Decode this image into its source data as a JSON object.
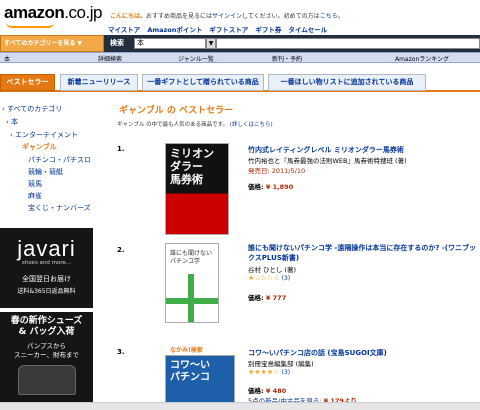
{
  "header": {
    "logo_text": "amazon",
    "logo_suffix": ".co.jp",
    "greeting_hi": "こんにちは。",
    "greeting_rest": "おすすめ商品を見るには",
    "signin_link": "サインイン",
    "greeting_tail": "してください。初めての方は",
    "here_link": "こちら",
    "greeting_end": "。",
    "top_links": [
      "マイストア",
      "Amazonポイント",
      "ギフトストア",
      "ギフト券",
      "タイムセール"
    ]
  },
  "search": {
    "category_button": "すべてのカテゴリーを見る",
    "label": "検索",
    "scope_value": "本"
  },
  "nav": {
    "items": [
      "本",
      "詳細検索",
      "ジャンル一覧",
      "新刊・予約",
      "Amazonランキング"
    ]
  },
  "tabs": [
    {
      "label": "ベストセラー",
      "active": true
    },
    {
      "label": "新着ニューリリース",
      "active": false
    },
    {
      "label": "一番ギフトとして贈られている商品",
      "active": false
    },
    {
      "label": "一番ほしい物リストに追加されている商品",
      "active": false
    }
  ],
  "sidebar": {
    "items": [
      "‹ すべてのカテゴリ",
      "‹ 本",
      "‹ エンターテイメント",
      "ギャンブル",
      "パチンコ・パチスロ",
      "競輪・競艇",
      "競馬",
      "麻雀",
      "宝くじ・ナンバーズ"
    ],
    "current_index": 3
  },
  "ads": {
    "javari_brand": "javari",
    "javari_sub": "shoes and more...",
    "javari_line1": "全国翌日お届け",
    "javari_line2": "送料&365日返品無料",
    "spring_heading1": "春の新作シューズ",
    "spring_heading2": "& バッグ入荷",
    "spring_body1": "パンプスから",
    "spring_body2": "スニーカー、財布まで"
  },
  "main": {
    "title": "ギャンブル の ベストセラー",
    "subtitle": "ギャンブル の中で最も人気のある商品です。",
    "subtitle_link": "詳しくはこちら",
    "items": [
      {
        "rank": "1.",
        "title": "竹内式レイティングレベル ミリオンダラー馬券術",
        "author": "竹内裕也と『馬券最強の法則WEB』馬券術特捜班 (著)",
        "date": "発売日: 2011/5/10",
        "price_label": "価格:",
        "price": "¥ 1,890",
        "cover_text": "ミリオン\nダラー\n馬券術"
      },
      {
        "rank": "2.",
        "title": "誰にも聞けないパチンコ学 -遠隔操作は本当に存在するのか? -(ワニブックスPLUS新書)",
        "author": "谷村 ひとし (著)",
        "rating": "★☆☆☆☆",
        "rating_count": "(3)",
        "price_label": "価格:",
        "price": "¥ 777",
        "cover_text": "誰にも聞けない\nパチンコ学"
      },
      {
        "rank": "3.",
        "title": "コワ〜いパチンコ店の話 (宝島SUGOI文庫)",
        "author": "別冊宝島編集部 (編集)",
        "rating": "★★★★☆",
        "rating_count": "(3)",
        "price_label": "価格:",
        "price": "¥ 480",
        "used_text": "5点の新品/中古品を見る:",
        "used_price": "¥ 179より",
        "cover_badge": "なかみ!検索",
        "cover_text": "コワ〜い\nパチンコ"
      }
    ]
  },
  "colors": {
    "accent": "#e47911",
    "link": "#003399",
    "price": "#b12704",
    "nav_bg": "#d4ddef",
    "search_bg": "#232f3e"
  }
}
